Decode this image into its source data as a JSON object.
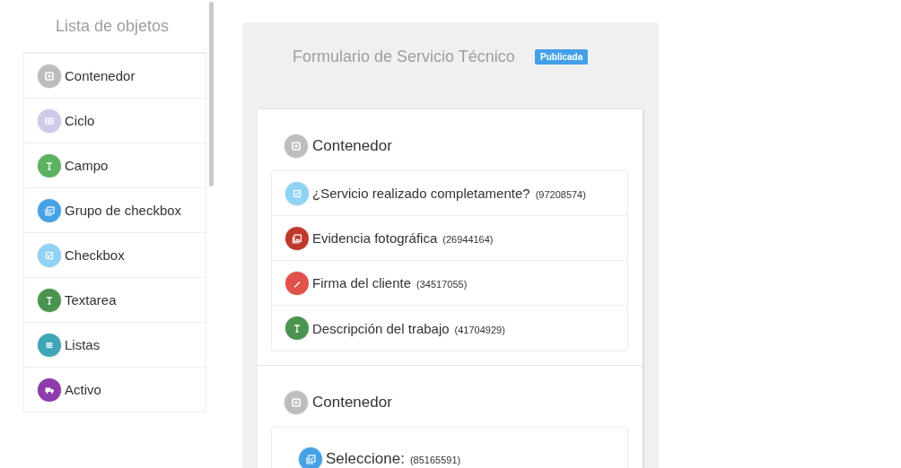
{
  "sidebar": {
    "title": "Lista de objetos",
    "items": [
      {
        "label": "Contenedor",
        "kind": "container"
      },
      {
        "label": "Ciclo",
        "kind": "cycle"
      },
      {
        "label": "Campo",
        "kind": "field"
      },
      {
        "label": "Grupo de checkbox",
        "kind": "checkgroup"
      },
      {
        "label": "Checkbox",
        "kind": "checkbox"
      },
      {
        "label": "Textarea",
        "kind": "textarea"
      },
      {
        "label": "Listas",
        "kind": "list"
      },
      {
        "label": "Activo",
        "kind": "asset"
      }
    ]
  },
  "form": {
    "title": "Formulario de Servicio Técnico",
    "status_badge": "Publicada",
    "sections": [
      {
        "heading": "Contenedor",
        "kind": "container",
        "items": [
          {
            "label": "¿Servicio realizado completamente?",
            "id": "(97208574)",
            "kind": "checkbox"
          },
          {
            "label": "Evidencia fotográfica",
            "id": "(26944164)",
            "kind": "image"
          },
          {
            "label": "Firma del cliente",
            "id": "(34517055)",
            "kind": "signature"
          },
          {
            "label": "Descripción del trabajo",
            "id": "(41704929)",
            "kind": "textarea"
          }
        ]
      },
      {
        "heading": "Contenedor",
        "kind": "container",
        "items": [
          {
            "label": "Seleccione:",
            "id": "(85165591)",
            "kind": "checkgroup"
          }
        ]
      }
    ]
  }
}
